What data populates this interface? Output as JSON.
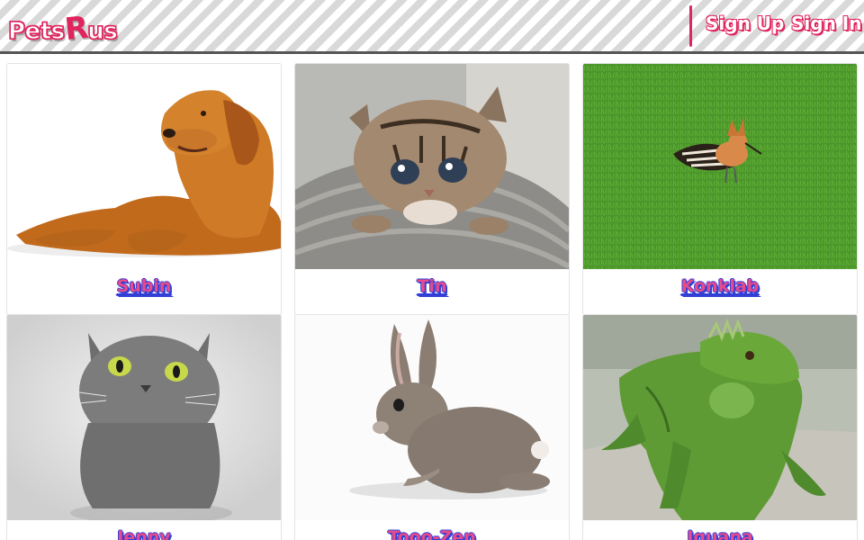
{
  "brand": {
    "logo_left": "Pets",
    "logo_r": "R",
    "logo_right": "us",
    "accent_color": "#e0245e"
  },
  "nav": {
    "sign_up": "Sign Up",
    "sign_in": "Sign In"
  },
  "pets": [
    {
      "name": "Subin",
      "animal": "golden-retriever"
    },
    {
      "name": "Tin",
      "animal": "tabby-kitten"
    },
    {
      "name": "Konklab",
      "animal": "hoopoe-bird"
    },
    {
      "name": "Jenny",
      "animal": "gray-cat"
    },
    {
      "name": "Tooo-Zen",
      "animal": "rabbit"
    },
    {
      "name": "Iguana",
      "animal": "green-iguana"
    }
  ]
}
